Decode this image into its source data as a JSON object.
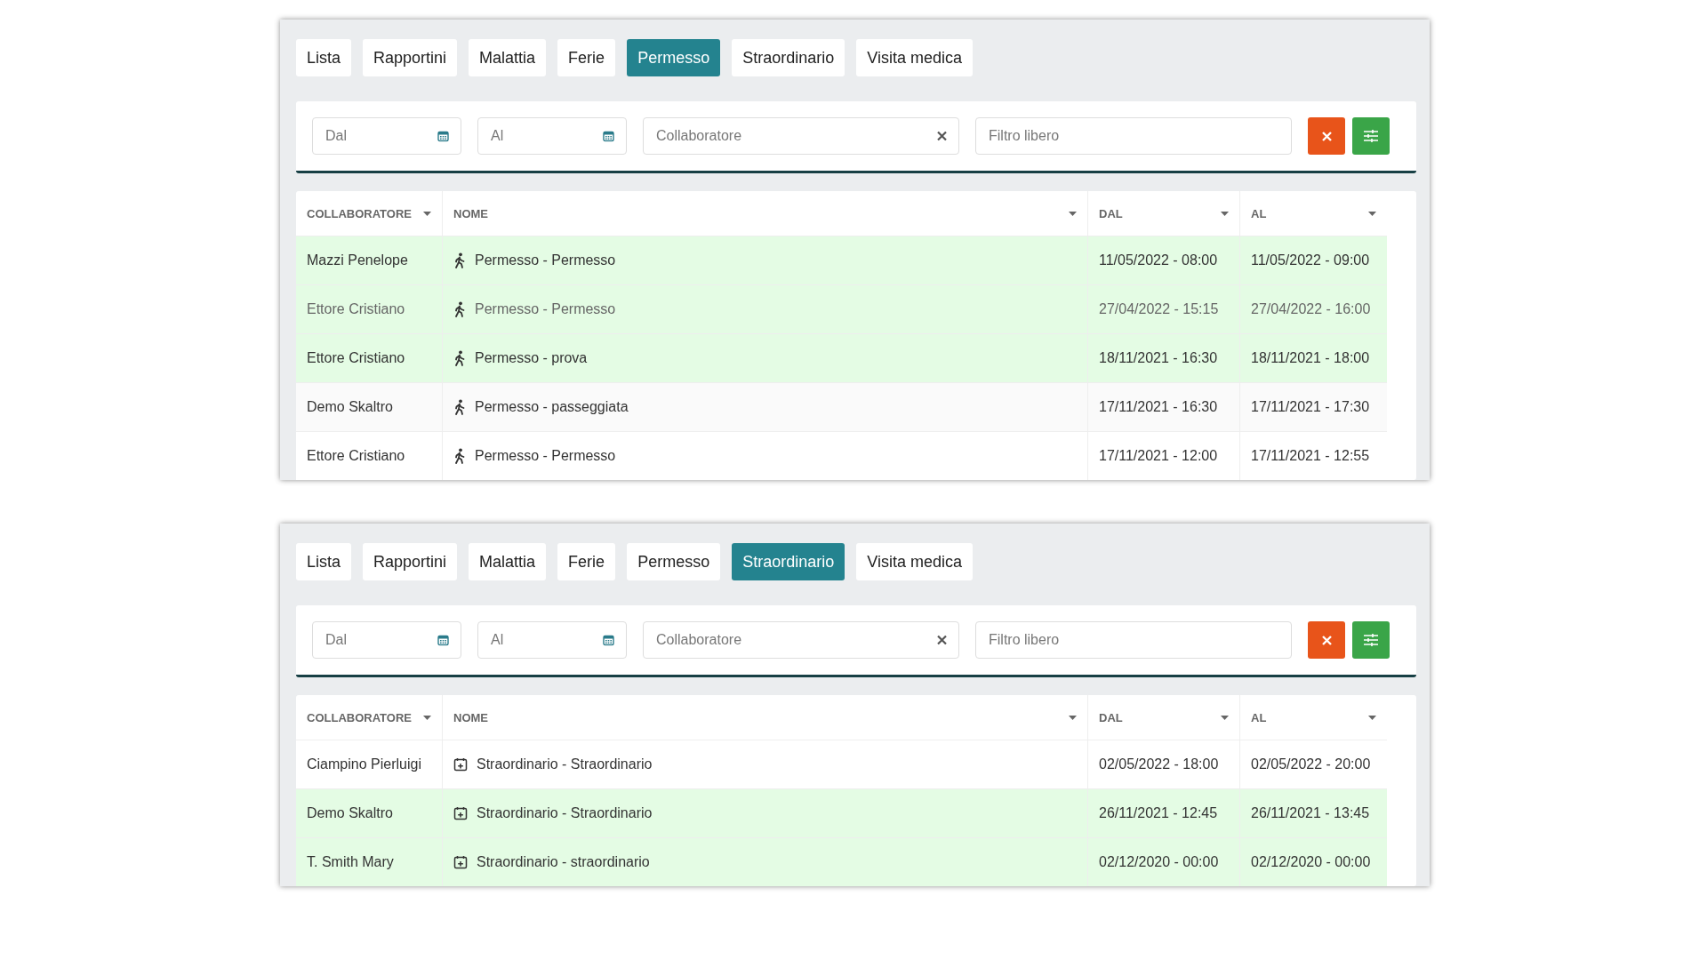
{
  "panels": [
    {
      "tabs": [
        {
          "label": "Lista",
          "selected": false
        },
        {
          "label": "Rapportini",
          "selected": false
        },
        {
          "label": "Malattia",
          "selected": false
        },
        {
          "label": "Ferie",
          "selected": false
        },
        {
          "label": "Permesso",
          "selected": true
        },
        {
          "label": "Straordinario",
          "selected": false
        },
        {
          "label": "Visita medica",
          "selected": false
        }
      ],
      "filters": {
        "from": {
          "placeholder": "Dal"
        },
        "to": {
          "placeholder": "Al"
        },
        "collaborator": {
          "placeholder": "Collaboratore"
        },
        "search": {
          "placeholder": "Filtro libero"
        }
      },
      "table": {
        "columns": [
          "COLLABORATORE",
          "NOME",
          "DAL",
          "AL"
        ],
        "rows": [
          {
            "collaboratore": "Mazzi Penelope",
            "kind": "walk",
            "nome": "Permesso - Permesso",
            "dal": "11/05/2022 - 08:00",
            "al": "11/05/2022 - 09:00",
            "highlighted": true,
            "dimmed": false
          },
          {
            "collaboratore": "Ettore Cristiano",
            "kind": "walk",
            "nome": "Permesso - Permesso",
            "dal": "27/04/2022 - 15:15",
            "al": "27/04/2022 - 16:00",
            "highlighted": true,
            "dimmed": true
          },
          {
            "collaboratore": "Ettore Cristiano",
            "kind": "walk",
            "nome": "Permesso - prova",
            "dal": "18/11/2021 - 16:30",
            "al": "18/11/2021 - 18:00",
            "highlighted": true,
            "dimmed": false
          },
          {
            "collaboratore": "Demo Skaltro",
            "kind": "walk",
            "nome": "Permesso - passeggiata",
            "dal": "17/11/2021 - 16:30",
            "al": "17/11/2021 - 17:30",
            "highlighted": false,
            "dimmed": false
          },
          {
            "collaboratore": "Ettore Cristiano",
            "kind": "walk",
            "nome": "Permesso - Permesso",
            "dal": "17/11/2021 - 12:00",
            "al": "17/11/2021 - 12:55",
            "highlighted": false,
            "dimmed": false
          }
        ]
      }
    },
    {
      "tabs": [
        {
          "label": "Lista",
          "selected": false
        },
        {
          "label": "Rapportini",
          "selected": false
        },
        {
          "label": "Malattia",
          "selected": false
        },
        {
          "label": "Ferie",
          "selected": false
        },
        {
          "label": "Permesso",
          "selected": false
        },
        {
          "label": "Straordinario",
          "selected": true
        },
        {
          "label": "Visita medica",
          "selected": false
        }
      ],
      "filters": {
        "from": {
          "placeholder": "Dal"
        },
        "to": {
          "placeholder": "Al"
        },
        "collaborator": {
          "placeholder": "Collaboratore"
        },
        "search": {
          "placeholder": "Filtro libero"
        }
      },
      "table": {
        "columns": [
          "COLLABORATORE",
          "NOME",
          "DAL",
          "AL"
        ],
        "rows": [
          {
            "collaboratore": "Ciampino Pierluigi",
            "kind": "calendar",
            "nome": "Straordinario - Straordinario",
            "dal": "02/05/2022 - 18:00",
            "al": "02/05/2022 - 20:00",
            "highlighted": false,
            "dimmed": false
          },
          {
            "collaboratore": "Demo Skaltro",
            "kind": "calendar",
            "nome": "Straordinario - Straordinario",
            "dal": "26/11/2021 - 12:45",
            "al": "26/11/2021 - 13:45",
            "highlighted": true,
            "dimmed": false
          },
          {
            "collaboratore": "T. Smith Mary",
            "kind": "calendar",
            "nome": "Straordinario - straordinario",
            "dal": "02/12/2020 - 00:00",
            "al": "02/12/2020 - 00:00",
            "highlighted": true,
            "dimmed": false
          }
        ]
      }
    }
  ]
}
